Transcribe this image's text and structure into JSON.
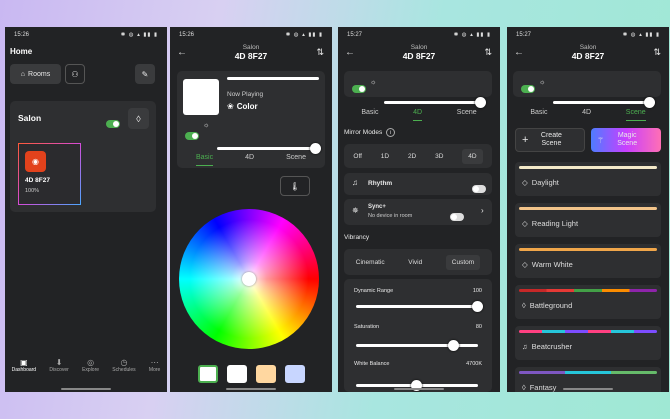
{
  "status_times": [
    "15:26",
    "15:26",
    "15:27",
    "15:27"
  ],
  "status_icons": "✱ ◍ ▴ ▮▮ ▮",
  "dashboard": {
    "title": "Home",
    "rooms_label": "Rooms",
    "room_name": "Salon",
    "device_name": "4D 8F27",
    "device_level": "100%",
    "nav": [
      "Dashboard",
      "Discover",
      "Explore",
      "Schedules",
      "More"
    ]
  },
  "device": {
    "room": "Salon",
    "name": "4D 8F27"
  },
  "basic": {
    "now_playing": "Now Playing",
    "mode": "Color",
    "tabs": [
      "Basic",
      "4D",
      "Scene"
    ],
    "swatches": [
      "#ffffff",
      "#ffffff",
      "#ffd7a0",
      "#c8d6ff"
    ]
  },
  "fourd": {
    "tabs": [
      "Basic",
      "4D",
      "Scene"
    ],
    "mirror_label": "Mirror Modes",
    "mirror_options": [
      "Off",
      "1D",
      "2D",
      "3D",
      "4D"
    ],
    "mirror_selected": "4D",
    "rhythm": "Rhythm",
    "sync_title": "Sync+",
    "sync_sub": "No device in room",
    "vibrancy_label": "Vibrancy",
    "vibrancy_options": [
      "Cinematic",
      "Vivid",
      "Custom"
    ],
    "vibrancy_selected": "Custom",
    "dynamic_label": "Dynamic Range",
    "dynamic_value": "100",
    "dynamic_level": 1.0,
    "saturation_label": "Saturation",
    "saturation_value": "80",
    "saturation_level": 0.8,
    "white_label": "White Balance",
    "white_value": "4700K",
    "white_level": 0.5
  },
  "scene": {
    "tabs": [
      "Basic",
      "4D",
      "Scene"
    ],
    "create_label": "Create Scene",
    "magic_label": "Magic Scene",
    "items": [
      {
        "name": "Daylight",
        "colors": [
          "#f3e9c8"
        ]
      },
      {
        "name": "Reading Light",
        "colors": [
          "#f2c48a"
        ]
      },
      {
        "name": "Warm White",
        "colors": [
          "#f0a64a"
        ]
      },
      {
        "name": "Battleground",
        "colors": [
          "#c62828",
          "#e53935",
          "#43a047",
          "#fb8c00",
          "#8e24aa"
        ]
      },
      {
        "name": "Beatcrusher",
        "colors": [
          "#ff4081",
          "#26c6da",
          "#7c4dff",
          "#ff4081",
          "#26c6da",
          "#7c4dff"
        ]
      },
      {
        "name": "Fantasy",
        "colors": [
          "#7e57c2",
          "#26c6da",
          "#66bb6a"
        ]
      }
    ]
  }
}
